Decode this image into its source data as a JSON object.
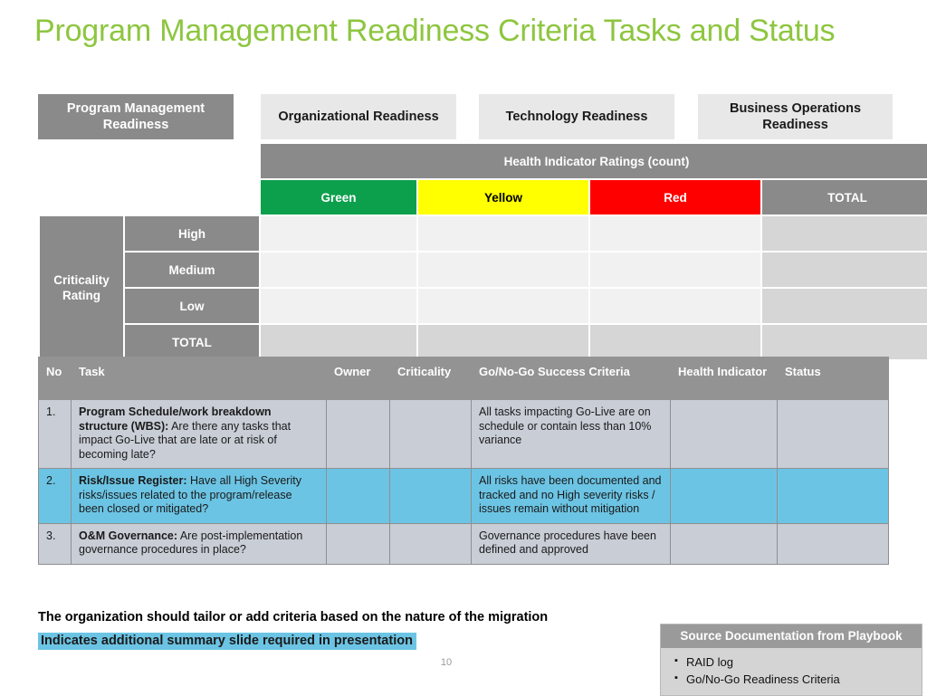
{
  "slide": {
    "title": "Program Management Readiness Criteria Tasks and Status",
    "page_number": "10",
    "title_color": "#8DC63F"
  },
  "tabs": [
    {
      "label": "Program Management Readiness",
      "state": "active"
    },
    {
      "label": "Organizational Readiness",
      "state": "inactive"
    },
    {
      "label": "Technology Readiness",
      "state": "inactive"
    },
    {
      "label": "Business Operations Readiness",
      "state": "inactive"
    }
  ],
  "matrix": {
    "group_header": "Health Indicator Ratings (count)",
    "row_group_label": "Criticality Rating",
    "columns": [
      {
        "label": "Green",
        "color": "#0DA04C",
        "text_color": "#FFFFFF"
      },
      {
        "label": "Yellow",
        "color": "#FFFF00",
        "text_color": "#000000"
      },
      {
        "label": "Red",
        "color": "#FF0000",
        "text_color": "#FFFFFF"
      },
      {
        "label": "TOTAL",
        "color": "#8A8A8A",
        "text_color": "#FFFFFF"
      }
    ],
    "rows": [
      {
        "label": "High",
        "green": "",
        "yellow": "",
        "red": "",
        "total": ""
      },
      {
        "label": "Medium",
        "green": "",
        "yellow": "",
        "red": "",
        "total": ""
      },
      {
        "label": "Low",
        "green": "",
        "yellow": "",
        "red": "",
        "total": ""
      },
      {
        "label": "TOTAL",
        "green": "",
        "yellow": "",
        "red": "",
        "total": ""
      }
    ]
  },
  "task_table": {
    "headers": {
      "no": "No",
      "task": "Task",
      "owner": "Owner",
      "criticality": "Criticality",
      "criteria": "Go/No-Go Success Criteria",
      "health": "Health Indicator",
      "status": "Status"
    },
    "rows": [
      {
        "no": "1.",
        "task_bold": "Program Schedule/work breakdown structure (WBS):",
        "task_rest": " Are there any tasks that impact Go-Live that are late or at risk of becoming late?",
        "owner": "",
        "criticality": "",
        "criteria": "All tasks impacting Go-Live are on schedule or contain less than 10% variance",
        "health": "",
        "status": "",
        "highlight": false
      },
      {
        "no": "2.",
        "task_bold": "Risk/Issue Register:",
        "task_rest": " Have all High Severity risks/issues related to the program/release been closed or mitigated?",
        "owner": "",
        "criticality": "",
        "criteria": "All risks have been documented and tracked and no High severity risks / issues remain without mitigation",
        "health": "",
        "status": "",
        "highlight": true
      },
      {
        "no": "3.",
        "task_bold": "O&M Governance:",
        "task_rest": " Are post-implementation governance procedures in place?",
        "owner": "",
        "criticality": "",
        "criteria": "Governance procedures have been defined and approved",
        "health": "",
        "status": "",
        "highlight": false
      }
    ]
  },
  "notes": {
    "note_tailor": "The organization should tailor or add criteria based on the nature of the migration",
    "note_summary": "Indicates additional summary slide required in presentation",
    "highlight_color": "#6CC4E4"
  },
  "source_box": {
    "title": "Source Documentation from Playbook",
    "items": [
      "RAID log",
      "Go/No-Go Readiness Criteria"
    ]
  }
}
